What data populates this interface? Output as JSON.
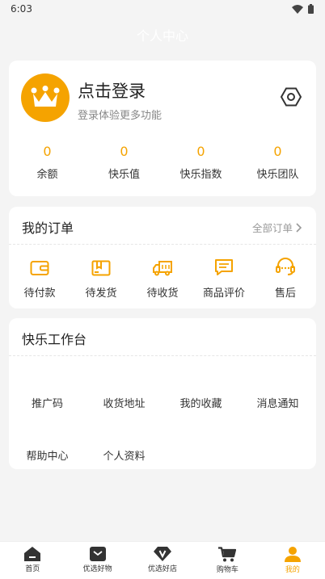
{
  "status_bar": {
    "time": "6:03"
  },
  "header": {
    "title": "个人中心"
  },
  "profile": {
    "login_title": "点击登录",
    "login_subtitle": "登录体验更多功能",
    "stats": [
      {
        "value": "0",
        "label": "余额"
      },
      {
        "value": "0",
        "label": "快乐值"
      },
      {
        "value": "0",
        "label": "快乐指数"
      },
      {
        "value": "0",
        "label": "快乐团队"
      }
    ]
  },
  "orders": {
    "title": "我的订单",
    "all_label": "全部订单",
    "items": [
      {
        "label": "待付款",
        "icon": "wallet-icon"
      },
      {
        "label": "待发货",
        "icon": "box-icon"
      },
      {
        "label": "待收货",
        "icon": "truck-icon"
      },
      {
        "label": "商品评价",
        "icon": "comment-icon"
      },
      {
        "label": "售后",
        "icon": "headset-icon"
      }
    ]
  },
  "workbench": {
    "title": "快乐工作台",
    "items": [
      {
        "label": "推广码"
      },
      {
        "label": "收货地址"
      },
      {
        "label": "我的收藏"
      },
      {
        "label": "消息通知"
      },
      {
        "label": "帮助中心"
      },
      {
        "label": "个人资料"
      }
    ]
  },
  "tabbar": {
    "items": [
      {
        "label": "首页",
        "icon": "home-icon"
      },
      {
        "label": "优选好物",
        "icon": "mail-icon"
      },
      {
        "label": "优选好店",
        "icon": "v-badge-icon"
      },
      {
        "label": "购物车",
        "icon": "cart-icon"
      },
      {
        "label": "我的",
        "icon": "user-icon",
        "active": true
      }
    ]
  },
  "colors": {
    "accent": "#f5a300",
    "background": "#f4f4f4"
  }
}
